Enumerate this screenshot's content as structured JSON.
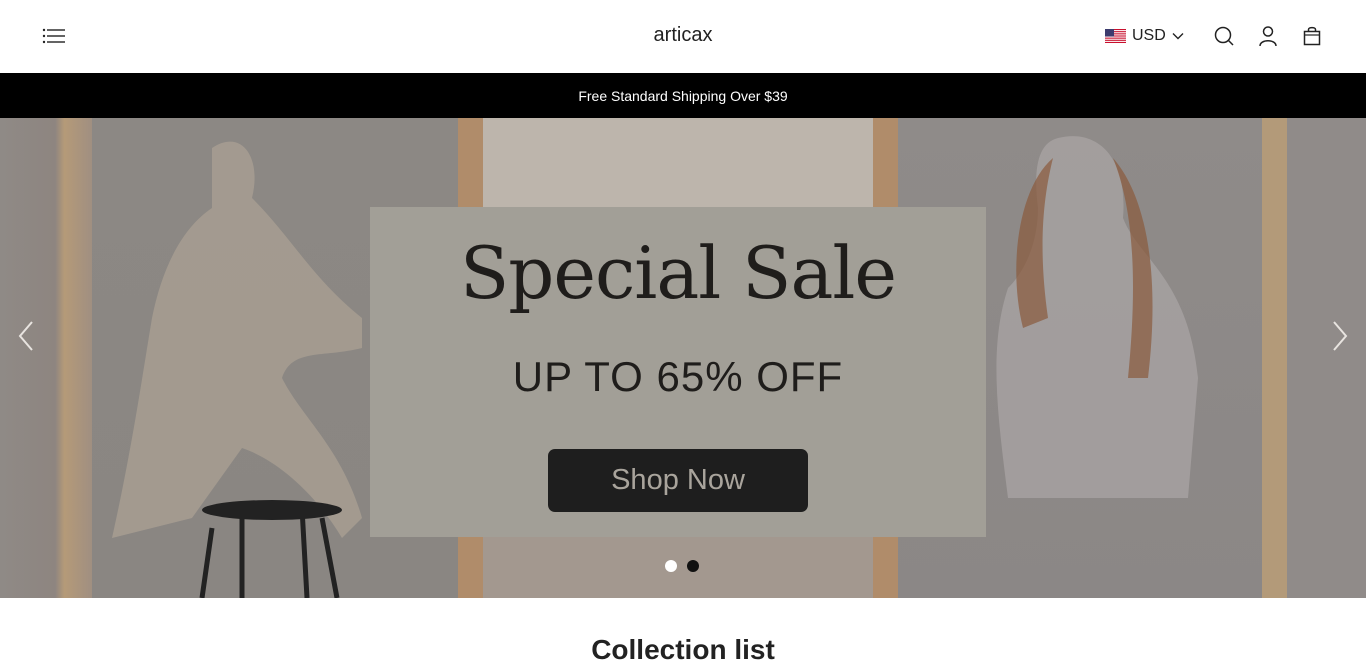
{
  "header": {
    "brand": "articax",
    "currency": {
      "code": "USD",
      "flag": "us-flag-icon"
    },
    "icons": [
      "menu-icon",
      "search-icon",
      "account-icon",
      "cart-icon"
    ]
  },
  "announcement": {
    "text": "Free Standard Shipping Over $39"
  },
  "hero": {
    "title": "Special Sale",
    "subtitle": "UP TO 65% OFF",
    "cta_label": "Shop Now",
    "slides_total": 2,
    "active_slide": 1
  },
  "collection": {
    "title": "Collection list"
  },
  "colors": {
    "announcement_bg": "#000000",
    "cta_bg": "#1e1e1e",
    "card_bg": "#a29f97"
  }
}
